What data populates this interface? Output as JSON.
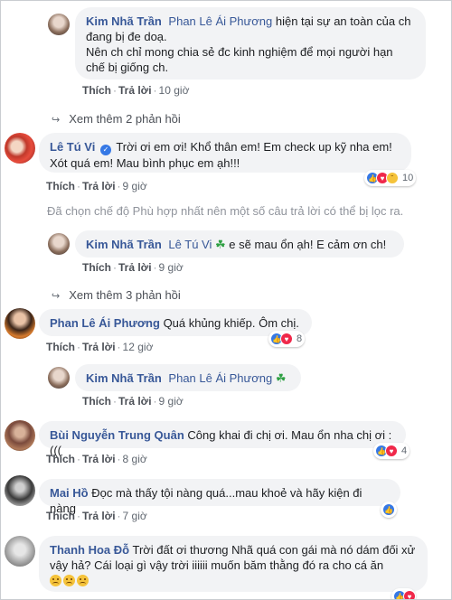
{
  "colors": {
    "name_link": "#385898",
    "bubble_bg": "#f2f3f5",
    "meta_text": "#606770",
    "like_blue": "#3578e5",
    "love_red": "#f0284a"
  },
  "comments": [
    {
      "name": "Kim Nhã Trần",
      "tag": "Phan Lê Ái Phương",
      "text": " hiện tại sự an toàn của ch đang bị đe doạ.",
      "text2": "Nên ch chỉ mong chia sẻ đc kinh nghiệm để mọi người hạn chế bị giống ch.",
      "like": "Thích",
      "reply": "Trả lời",
      "time": "10 giờ"
    },
    {
      "name": "Lê Tú Vi",
      "text": " Trời ơi em ơi! Khổ thân em! Em check up kỹ nha em! Xót quá em! Mau bình phục em ạh!!!",
      "like": "Thích",
      "reply": "Trả lời",
      "time": "9 giờ",
      "reactions": "10"
    },
    {
      "name": "Kim Nhã Trần",
      "tag": "Lê Tú Vi",
      "text": " e sẽ mau ổn ạh! E cảm ơn ch!",
      "like": "Thích",
      "reply": "Trả lời",
      "time": "9 giờ"
    },
    {
      "name": "Phan Lê Ái Phương",
      "text": " Quá khủng khiếp. Ôm chị.",
      "like": "Thích",
      "reply": "Trả lời",
      "time": "12 giờ",
      "reactions": "8"
    },
    {
      "name": "Kim Nhã Trần",
      "tag": "Phan Lê Ái Phương",
      "like": "Thích",
      "reply": "Trả lời",
      "time": "9 giờ"
    },
    {
      "name": "Bùi Nguyễn Trung Quân",
      "text": " Công khai đi chị ơi. Mau ổn nha chị ơi :(((",
      "like": "Thích",
      "reply": "Trả lời",
      "time": "8 giờ",
      "reactions": "4"
    },
    {
      "name": "Mai Hồ",
      "text": " Đọc mà thấy tội nàng quá...mau khoẻ và hãy kiện đi nàng",
      "like": "Thích",
      "reply": "Trả lời",
      "time": "7 giờ"
    },
    {
      "name": "Thanh Hoa Đỗ",
      "text": " Trời đất ơi thương Nhã quá con gái mà nó dám đối xử vậy hả? Cái loại gì vậy trời iiiiii muốn băm thằng đó ra cho cá ăn"
    }
  ],
  "more_replies_1": "Xem thêm 2 phản hồi",
  "more_replies_2": "Xem thêm 3 phản hồi",
  "filter_notice": "Đã chọn chế độ Phù hợp nhất nên một số câu trả lời có thể bị lọc ra."
}
